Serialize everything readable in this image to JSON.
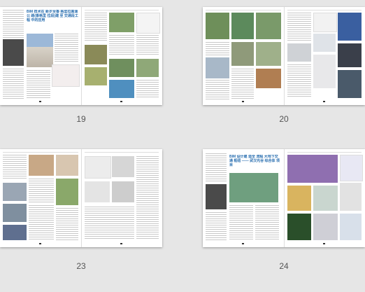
{
  "spreads": [
    {
      "page_label": "19",
      "headline": "BIM 技术在 新岁至香 格里拉高速公 路(香格里 拉段)建 至 交通段工程 中的应用"
    },
    {
      "page_label": "20"
    },
    {
      "page_label": "23"
    },
    {
      "page_label": "24",
      "headline": "BIM 设计建 造全 流程 大地下交通 枢纽 —— 武汉光谷 综合体 项目"
    }
  ],
  "colors": {
    "background": "#e6e6e6",
    "page": "#ffffff",
    "accent": "#2a6fb0"
  }
}
